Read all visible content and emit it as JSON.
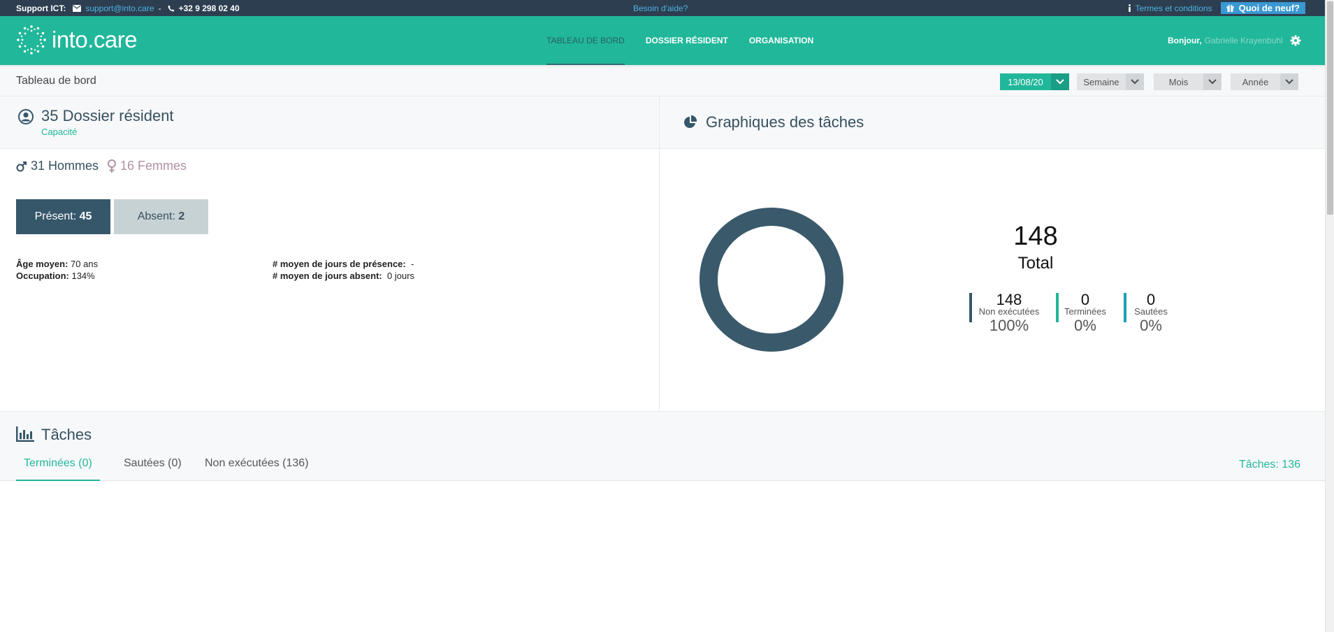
{
  "support_bar": {
    "label": "Support ICT:",
    "email": "support@into.care",
    "separator": "-",
    "phone": "+32 9 298 02 40",
    "help": "Besoin d'aide?",
    "terms": "Termes et conditions",
    "whats_new": "Quoi de neuf?"
  },
  "header": {
    "logo_text": "into.care",
    "nav": [
      {
        "label": "TABLEAU DE BORD",
        "active": true
      },
      {
        "label": "DOSSIER RÉSIDENT",
        "active": false
      },
      {
        "label": "ORGANISATION",
        "active": false
      }
    ],
    "greeting": "Bonjour,",
    "user_name": "Gabrielle Krayenbuhl"
  },
  "filter_bar": {
    "title": "Tableau de bord",
    "date": "13/08/20",
    "week": "Semaine",
    "month": "Mois",
    "year": "Année"
  },
  "residents": {
    "title": "35 Dossier résident",
    "subtitle": "Capacité",
    "men": "31 Hommes",
    "women": "16 Femmes",
    "present_label": "Présent:",
    "present_count": "45",
    "absent_label": "Absent:",
    "absent_count": "2",
    "stats": {
      "avg_age_label": "Âge moyen:",
      "avg_age_value": "70 ans",
      "occupation_label": "Occupation:",
      "occupation_value": "134%",
      "avg_presence_label": "# moyen de jours de présence:",
      "avg_presence_value": "-",
      "avg_absent_label": "# moyen de jours absent:",
      "avg_absent_value": "0 jours"
    }
  },
  "task_chart": {
    "title": "Graphiques des tâches",
    "total": "148",
    "total_label": "Total",
    "legend": [
      {
        "count": "148",
        "label": "Non exécutées",
        "percent": "100%",
        "color": "#36576a"
      },
      {
        "count": "0",
        "label": "Terminées",
        "percent": "0%",
        "color": "#21b79a"
      },
      {
        "count": "0",
        "label": "Sautées",
        "percent": "0%",
        "color": "#1d9fb3"
      }
    ]
  },
  "tasks": {
    "title": "Tâches",
    "tabs": [
      {
        "label": "Terminées (0)",
        "active": true
      },
      {
        "label": "Sautées (0)",
        "active": false
      },
      {
        "label": "Non exécutées (136)",
        "active": false
      }
    ],
    "count": "Tâches: 136"
  },
  "colors": {
    "brand": "#21b79a",
    "dark": "#36576a",
    "topbar": "#2c3e50"
  }
}
